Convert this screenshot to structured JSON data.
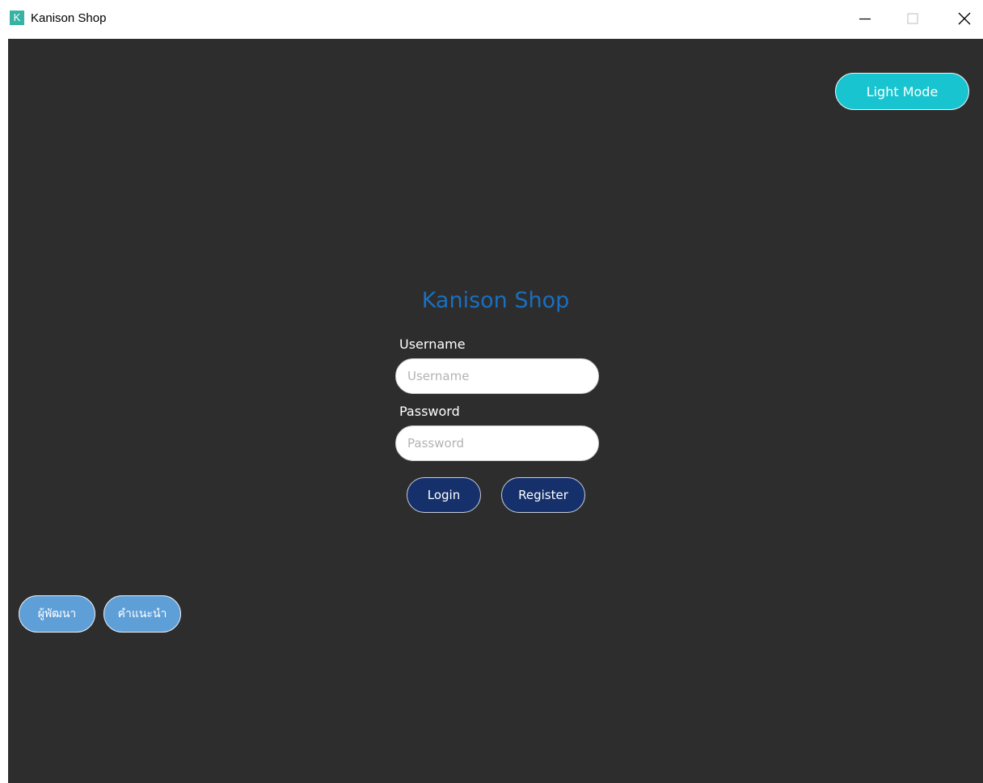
{
  "window": {
    "icon_letter": "K",
    "title": "Kanison Shop",
    "minimize_icon": "minimize-icon",
    "maximize_icon": "maximize-icon",
    "close_icon": "close-icon"
  },
  "header": {
    "light_mode_label": "Light Mode"
  },
  "login": {
    "title": "Kanison Shop",
    "username_label": "Username",
    "username_placeholder": "Username",
    "username_value": "",
    "password_label": "Password",
    "password_placeholder": "Password",
    "password_value": "",
    "login_label": "Login",
    "register_label": "Register"
  },
  "footer": {
    "developer_label": "ผู้พัฒนา",
    "guide_label": "คำแนะนำ"
  },
  "colors": {
    "background": "#2d2d2d",
    "title_accent": "#1a6fc0",
    "light_mode_button": "#18c4cf",
    "primary_button": "#15306b",
    "footer_button": "#5f9fd8"
  }
}
